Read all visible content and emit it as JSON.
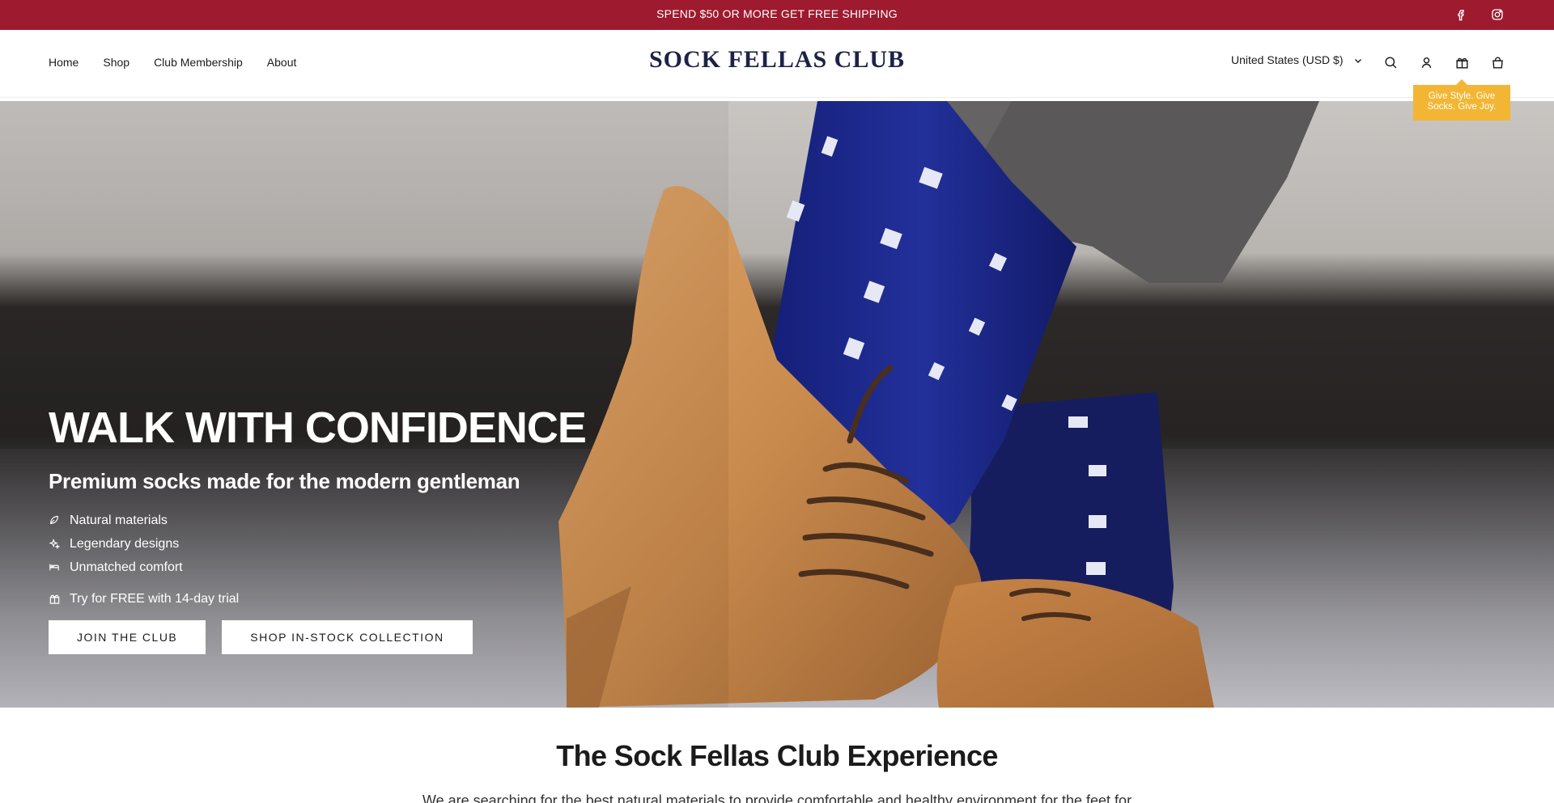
{
  "announcement": {
    "text": "SPEND $50 OR MORE GET FREE SHIPPING",
    "background": "#9e1a2e",
    "social": [
      {
        "icon": "facebook-icon"
      },
      {
        "icon": "instagram-icon"
      }
    ]
  },
  "header": {
    "nav": [
      {
        "label": "Home"
      },
      {
        "label": "Shop"
      },
      {
        "label": "Club Membership"
      },
      {
        "label": "About"
      }
    ],
    "logo": "SOCK FELLAS CLUB",
    "currency": "United States (USD $)",
    "icons": [
      "search-icon",
      "account-icon",
      "gift-icon",
      "cart-icon"
    ],
    "tooltip": "Give Style. Give Socks. Give Joy."
  },
  "hero": {
    "title": "WALK WITH CONFIDENCE",
    "subtitle": "Premium socks made for the modern gentleman",
    "features": [
      {
        "icon": "leaf-icon",
        "label": "Natural materials"
      },
      {
        "icon": "sparkle-icon",
        "label": "Legendary designs"
      },
      {
        "icon": "bed-icon",
        "label": "Unmatched comfort"
      }
    ],
    "trial": {
      "icon": "gift-icon",
      "label": "Try for FREE with 14-day trial"
    },
    "buttons": {
      "join": "JOIN THE CLUB",
      "shop": "SHOP IN-STOCK COLLECTION"
    }
  },
  "experience": {
    "title": "The Sock Fellas Club Experience",
    "text": "We are searching for the best natural materials to provide comfortable and healthy environment for the feet for"
  },
  "colors": {
    "accent": "#9e1a2e",
    "logo": "#1d2247",
    "tooltip": "#f2b634",
    "sock_blue": "#1f2a8c",
    "shoe_tan": "#c88a4e"
  }
}
